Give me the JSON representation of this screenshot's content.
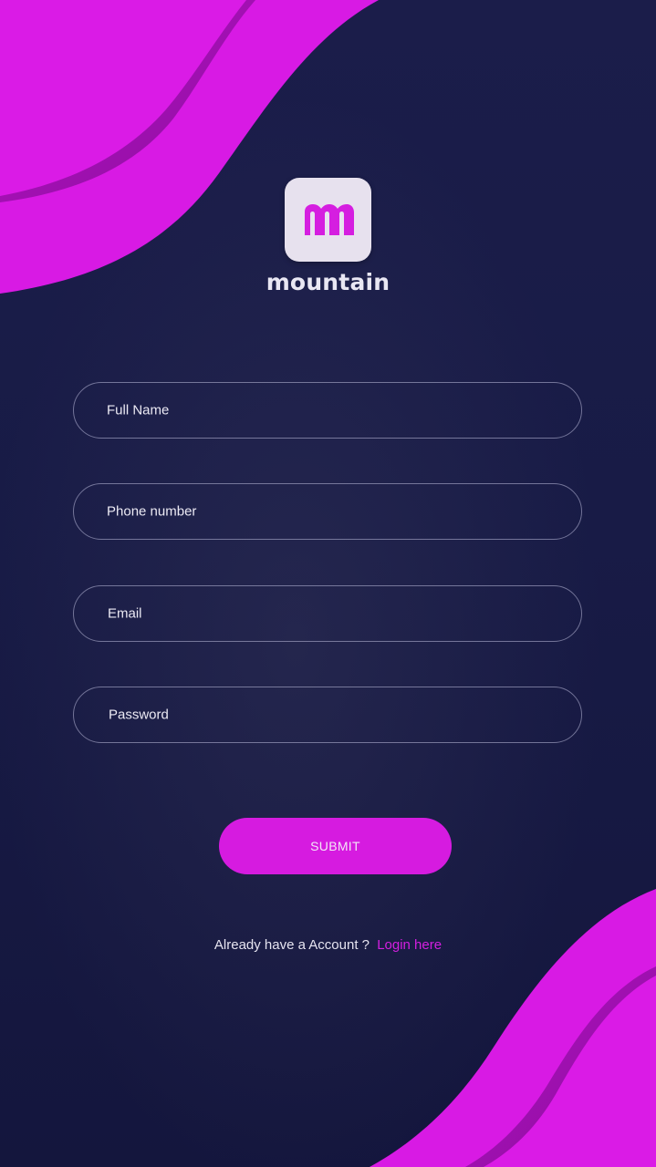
{
  "brand": {
    "logo_letter": "m",
    "name": "mountain"
  },
  "form": {
    "full_name_placeholder": "Full Name",
    "phone_placeholder": "Phone number",
    "email_placeholder": "Email",
    "password_placeholder": "Password",
    "submit_label": "SUBMIT"
  },
  "footer": {
    "prompt": "Already have a Account ?",
    "login_link": "Login here"
  },
  "colors": {
    "accent": "#d61be0",
    "background": "#161a44",
    "tile": "#e7e1ee"
  }
}
